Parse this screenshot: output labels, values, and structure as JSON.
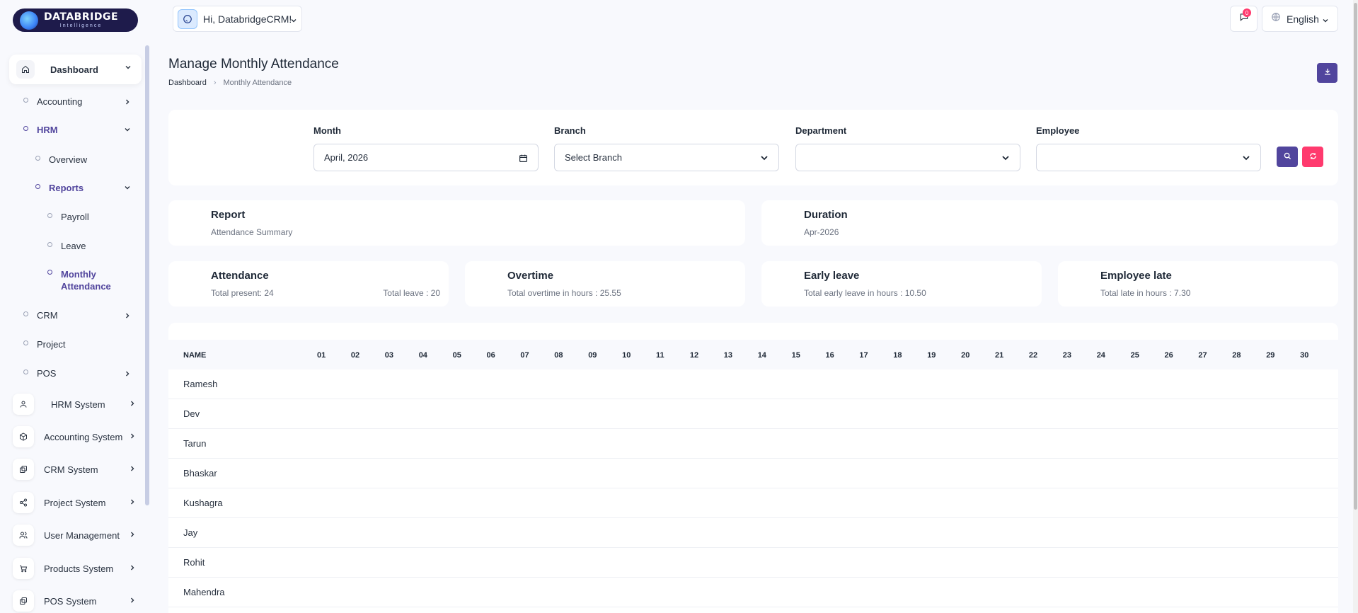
{
  "brand": {
    "name": "DATABRIDGE",
    "tagline": "Intelligence"
  },
  "header": {
    "greeting": "Hi, DatabridgeCRM!",
    "notification_count": "0",
    "language": "English"
  },
  "sidebar": {
    "dashboard": "Dashboard",
    "accounting": "Accounting",
    "hrm": "HRM",
    "overview": "Overview",
    "reports": "Reports",
    "payroll": "Payroll",
    "leave": "Leave",
    "monthly_attendance": "Monthly Attendance",
    "crm": "CRM",
    "project": "Project",
    "pos": "POS",
    "hrm_system": "HRM System",
    "accounting_system": "Accounting System",
    "crm_system": "CRM System",
    "project_system": "Project System",
    "user_management": "User Management",
    "products_system": "Products System",
    "pos_system": "POS System"
  },
  "page": {
    "title": "Manage Monthly Attendance",
    "breadcrumb": [
      "Dashboard",
      "Monthly Attendance"
    ]
  },
  "filters": {
    "month_label": "Month",
    "month_value": "April, 2026",
    "branch_label": "Branch",
    "branch_value": "Select Branch",
    "department_label": "Department",
    "department_value": "",
    "employee_label": "Employee",
    "employee_value": ""
  },
  "report": {
    "title": "Report",
    "value": "Attendance Summary"
  },
  "duration": {
    "title": "Duration",
    "value": "Apr-2026"
  },
  "stats": {
    "attendance": {
      "title": "Attendance",
      "present": "Total present: 24",
      "leave": "Total leave : 20"
    },
    "overtime": {
      "title": "Overtime",
      "value": "Total overtime in hours : 25.55"
    },
    "early_leave": {
      "title": "Early leave",
      "value": "Total early leave in hours : 10.50"
    },
    "late": {
      "title": "Employee late",
      "value": "Total late in hours : 7.30"
    }
  },
  "table": {
    "name_header": "NAME",
    "days": [
      "01",
      "02",
      "03",
      "04",
      "05",
      "06",
      "07",
      "08",
      "09",
      "10",
      "11",
      "12",
      "13",
      "14",
      "15",
      "16",
      "17",
      "18",
      "19",
      "20",
      "21",
      "22",
      "23",
      "24",
      "25",
      "26",
      "27",
      "28",
      "29",
      "30"
    ],
    "employees": [
      "Ramesh",
      "Dev",
      "Tarun",
      "Bhaskar",
      "Kushagra",
      "Jay",
      "Rohit",
      "Mahendra"
    ]
  }
}
